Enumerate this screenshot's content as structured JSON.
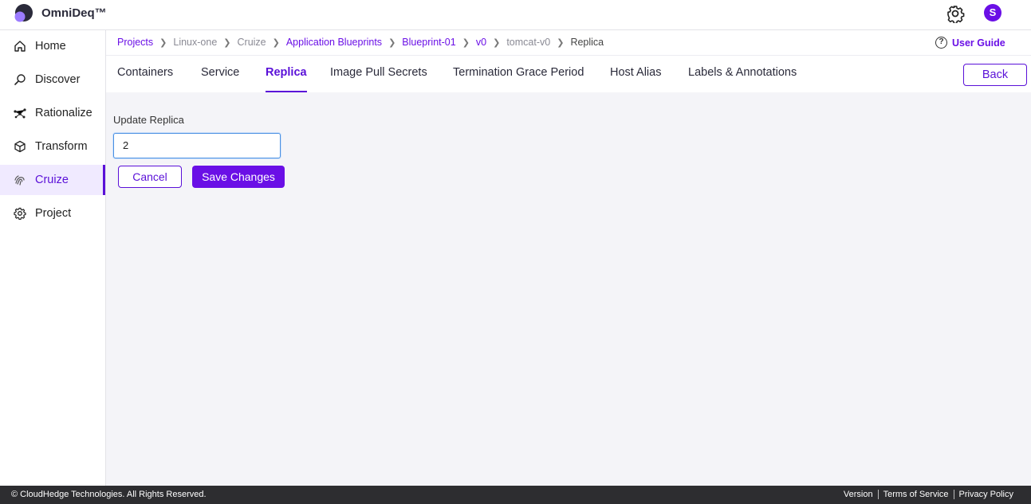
{
  "brand": {
    "name": "OmniDeq™"
  },
  "topbar": {
    "settings_icon": "gear-icon",
    "avatar_initial": "S",
    "accent": "#6a0fe6"
  },
  "sidebar": {
    "items": [
      {
        "label": "Home",
        "icon": "home-icon"
      },
      {
        "label": "Discover",
        "icon": "search-icon"
      },
      {
        "label": "Rationalize",
        "icon": "network-icon"
      },
      {
        "label": "Transform",
        "icon": "cube-icon"
      },
      {
        "label": "Cruize",
        "icon": "fingerprint-icon",
        "active": true
      },
      {
        "label": "Project",
        "icon": "gear-icon"
      }
    ]
  },
  "breadcrumb": [
    "Projects",
    "Linux-one",
    "Cruize",
    "Application Blueprints",
    "Blueprint-01",
    "v0",
    "tomcat-v0",
    "Replica"
  ],
  "user_guide": "User Guide",
  "tabs": [
    "Containers",
    "Service",
    "Replica",
    "Image Pull Secrets",
    "Termination Grace Period",
    "Host Alias",
    "Labels & Annotations"
  ],
  "active_tab": "Replica",
  "back_label": "Back",
  "form": {
    "label": "Update Replica",
    "value": "2",
    "cancel_label": "Cancel",
    "save_label": "Save Changes"
  },
  "footer": {
    "copyright": "© CloudHedge Technologies. All Rights Reserved.",
    "links": [
      "Version",
      "Terms of Service",
      "Privacy Policy"
    ]
  }
}
